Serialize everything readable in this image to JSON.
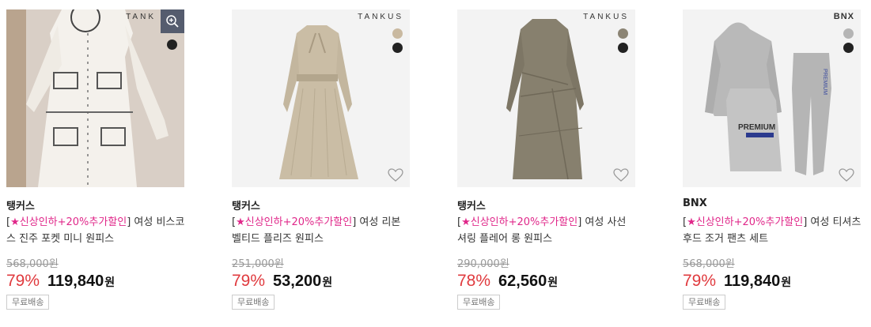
{
  "products": [
    {
      "brand_logo": "TANK",
      "brand": "탱커스",
      "title_prefix": "[",
      "title_tag": "★신상인하+20%추가할인",
      "title_suffix": "] 여성 비스코스 진주 포켓 미니 원피스",
      "original_price": "568,000원",
      "discount": "79%",
      "price": "119,840",
      "currency": "원",
      "shipping": "무료배송",
      "swatches": [
        "#222222"
      ],
      "icons": [
        "zoom-icon",
        "heart-icon"
      ]
    },
    {
      "brand_logo": "TANKUS",
      "brand": "탱커스",
      "title_prefix": "[",
      "title_tag": "★신상인하+20%추가할인",
      "title_suffix": "] 여성 리본 벨티드 플리즈 원피스",
      "original_price": "251,000원",
      "discount": "79%",
      "price": "53,200",
      "currency": "원",
      "shipping": "무료배송",
      "swatches": [
        "#c9b9a0",
        "#222222"
      ],
      "icons": [
        "heart-icon"
      ]
    },
    {
      "brand_logo": "TANKUS",
      "brand": "탱커스",
      "title_prefix": "[",
      "title_tag": "★신상인하+20%추가할인",
      "title_suffix": "] 여성 사선 셔링 플레어 롱 원피스",
      "original_price": "290,000원",
      "discount": "78%",
      "price": "62,560",
      "currency": "원",
      "shipping": "무료배송",
      "swatches": [
        "#8b8474",
        "#222222"
      ],
      "icons": [
        "heart-icon"
      ]
    },
    {
      "brand_logo": "BNX",
      "brand": "BNX",
      "title_prefix": "[",
      "title_tag": "★신상인하+20%추가할인",
      "title_suffix": "] 여성 티셔츠 후드 조거 팬츠 세트",
      "original_price": "568,000원",
      "discount": "79%",
      "price": "119,840",
      "currency": "원",
      "shipping": "무료배송",
      "swatches": [
        "#b5b5b5",
        "#222222"
      ],
      "icons": [
        "heart-icon"
      ]
    }
  ],
  "colors": {
    "discount": "#e03a3e",
    "tag": "#e0288a",
    "strike": "#999999"
  }
}
